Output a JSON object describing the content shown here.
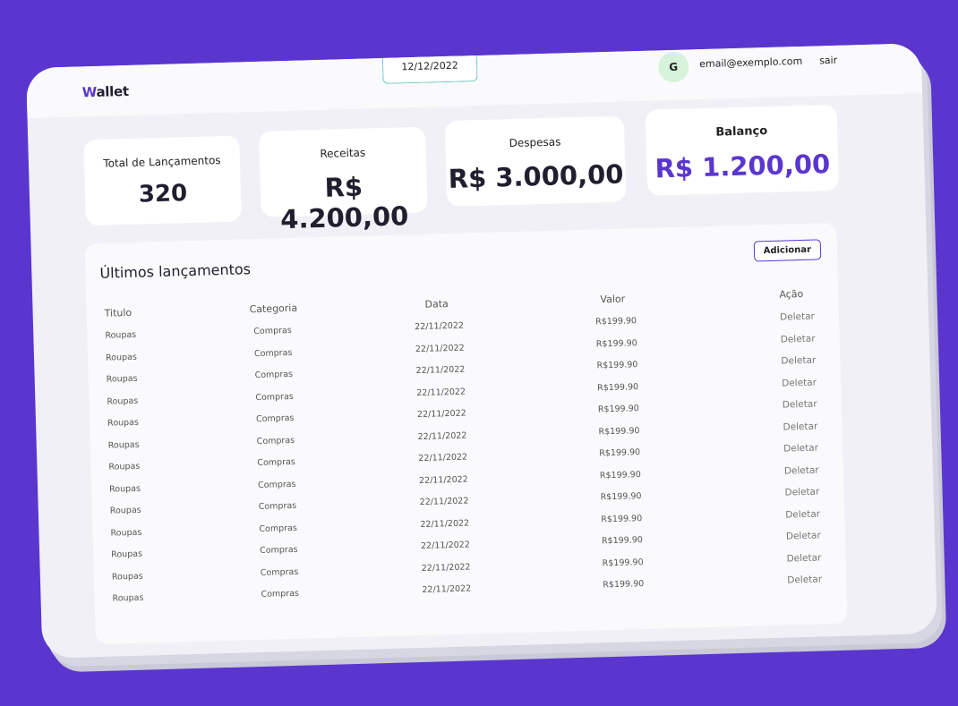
{
  "header": {
    "logo_prefix": "W",
    "logo_rest": "allet",
    "date": "12/12/2022",
    "avatar_initial": "G",
    "email": "email@exemplo.com",
    "logout_label": "sair"
  },
  "summary": {
    "total": {
      "label": "Total de Lançamentos",
      "value": "320"
    },
    "income": {
      "label": "Receitas",
      "value": "R$ 4.200,00"
    },
    "expenses": {
      "label": "Despesas",
      "value": "R$ 3.000,00"
    },
    "balance": {
      "label": "Balanço",
      "value": "R$ 1.200,00"
    }
  },
  "entries": {
    "title": "Últimos lançamentos",
    "add_label": "Adicionar",
    "columns": [
      "Titulo",
      "Categoria",
      "Data",
      "Valor",
      "Ação"
    ],
    "rows": [
      {
        "title": "Roupas",
        "category": "Compras",
        "date": "22/11/2022",
        "value": "R$199.90",
        "action": "Deletar"
      },
      {
        "title": "Roupas",
        "category": "Compras",
        "date": "22/11/2022",
        "value": "R$199.90",
        "action": "Deletar"
      },
      {
        "title": "Roupas",
        "category": "Compras",
        "date": "22/11/2022",
        "value": "R$199.90",
        "action": "Deletar"
      },
      {
        "title": "Roupas",
        "category": "Compras",
        "date": "22/11/2022",
        "value": "R$199.90",
        "action": "Deletar"
      },
      {
        "title": "Roupas",
        "category": "Compras",
        "date": "22/11/2022",
        "value": "R$199.90",
        "action": "Deletar"
      },
      {
        "title": "Roupas",
        "category": "Compras",
        "date": "22/11/2022",
        "value": "R$199.90",
        "action": "Deletar"
      },
      {
        "title": "Roupas",
        "category": "Compras",
        "date": "22/11/2022",
        "value": "R$199.90",
        "action": "Deletar"
      },
      {
        "title": "Roupas",
        "category": "Compras",
        "date": "22/11/2022",
        "value": "R$199.90",
        "action": "Deletar"
      },
      {
        "title": "Roupas",
        "category": "Compras",
        "date": "22/11/2022",
        "value": "R$199.90",
        "action": "Deletar"
      },
      {
        "title": "Roupas",
        "category": "Compras",
        "date": "22/11/2022",
        "value": "R$199.90",
        "action": "Deletar"
      },
      {
        "title": "Roupas",
        "category": "Compras",
        "date": "22/11/2022",
        "value": "R$199.90",
        "action": "Deletar"
      },
      {
        "title": "Roupas",
        "category": "Compras",
        "date": "22/11/2022",
        "value": "R$199.90",
        "action": "Deletar"
      },
      {
        "title": "Roupas",
        "category": "Compras",
        "date": "22/11/2022",
        "value": "R$199.90",
        "action": "Deletar"
      }
    ]
  },
  "colors": {
    "accent": "#5a36cf",
    "date_border": "#6fc7c6",
    "avatar_bg": "#d7f3d9"
  }
}
